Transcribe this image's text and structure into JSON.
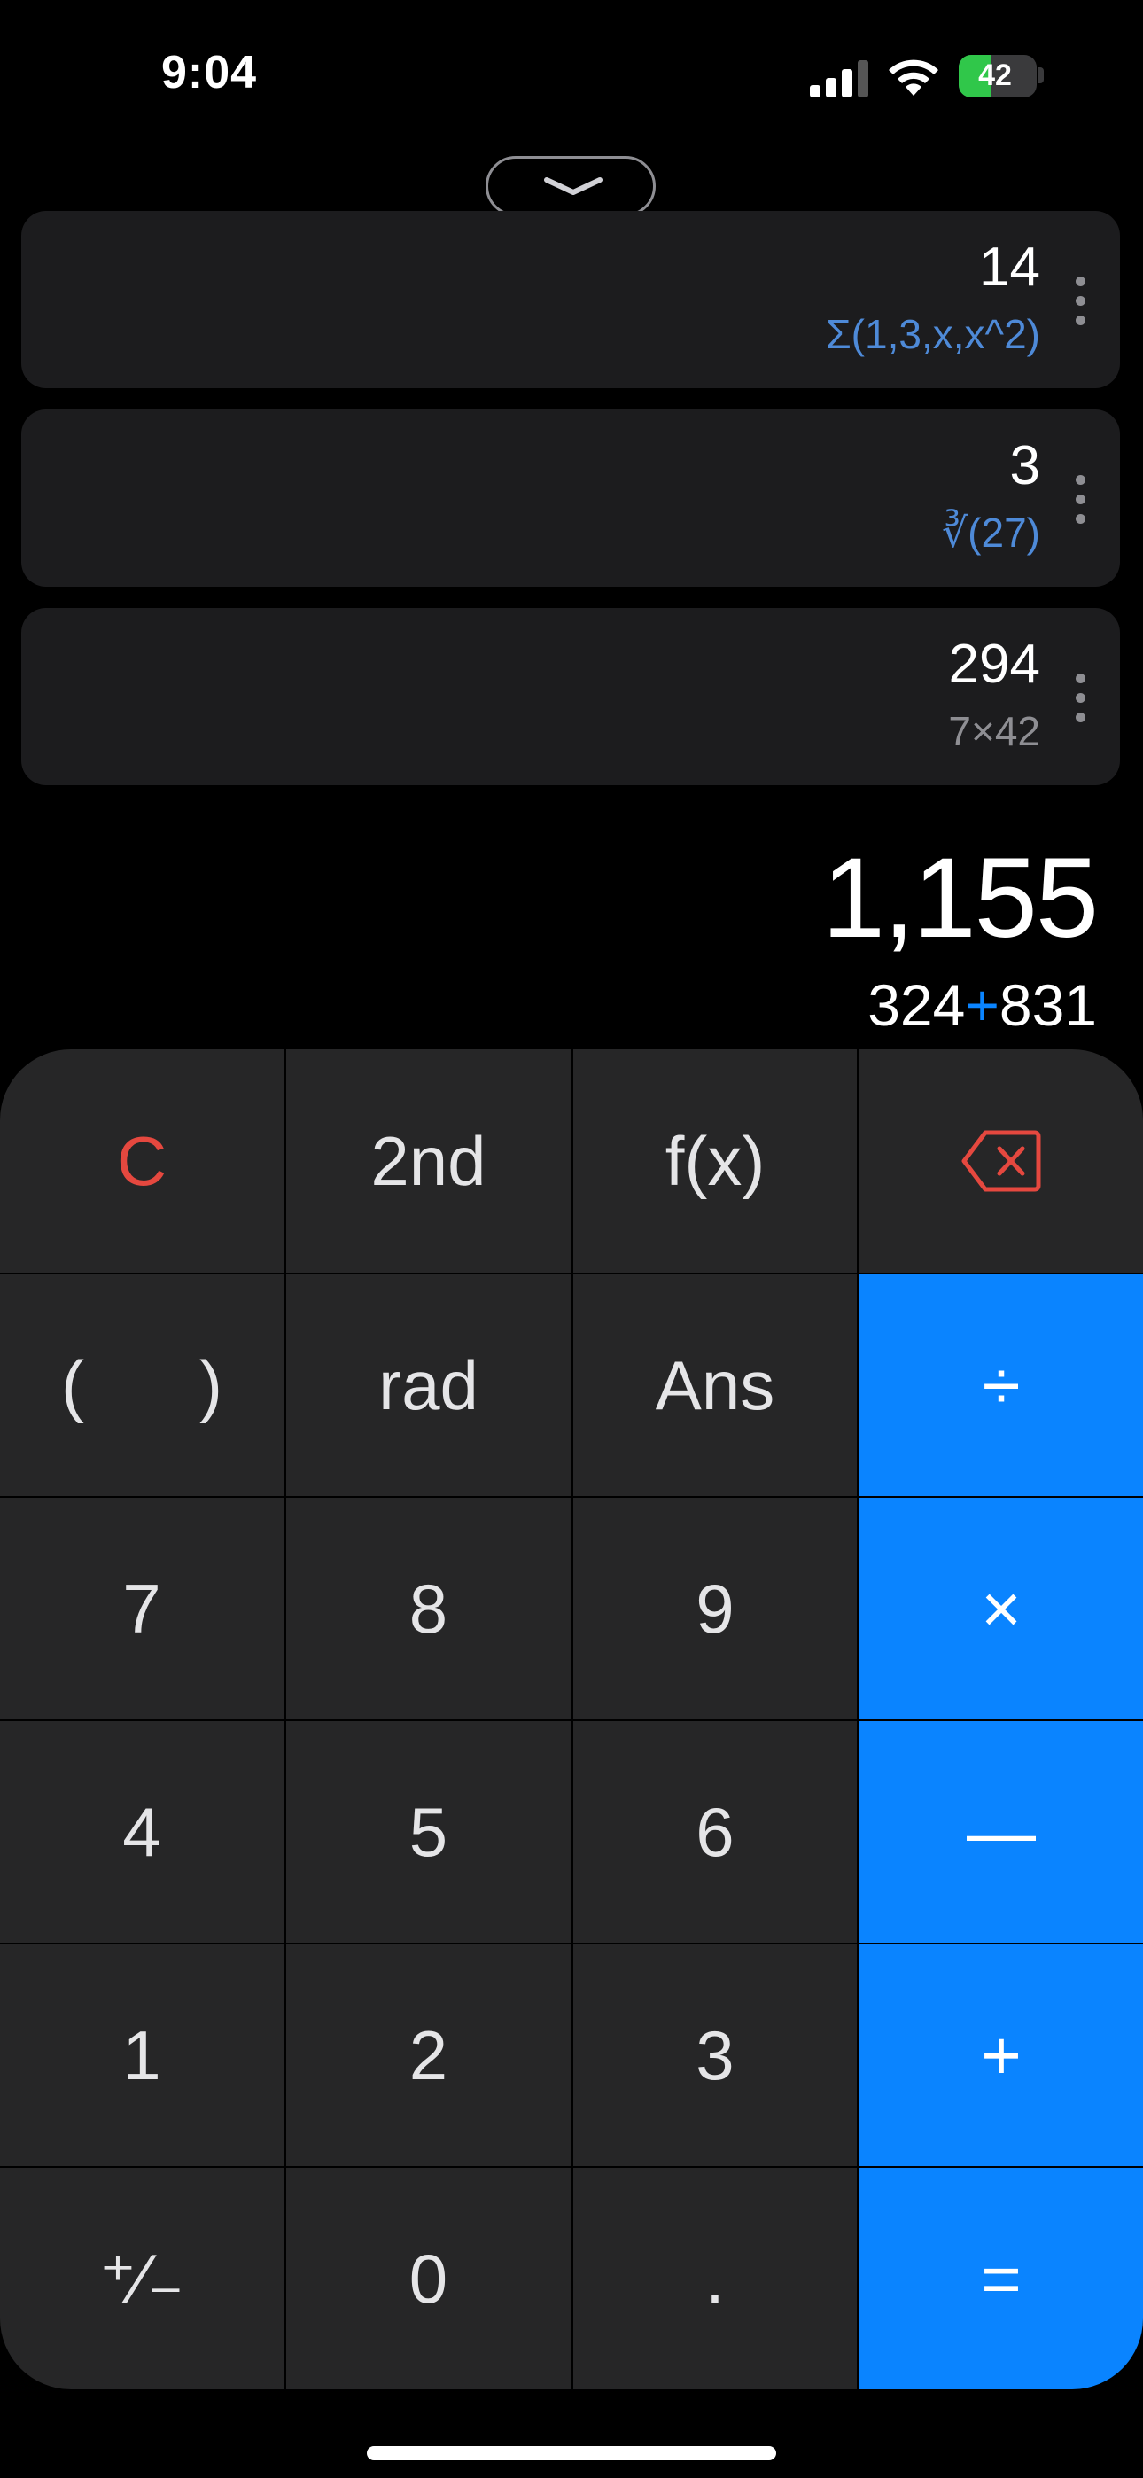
{
  "status_bar": {
    "time": "9:04",
    "battery_percent": "42",
    "battery_level": 0.42,
    "signal_bars": 3,
    "icons": [
      "cellular-signal-icon",
      "wifi-icon",
      "battery-charging-icon"
    ]
  },
  "history": [
    {
      "result": "14",
      "expression": "Σ(1,3,x,x^2)",
      "expression_color": "#4e8ad8"
    },
    {
      "result": "3",
      "expression": "∛(27)",
      "expression_color": "#4e8ad8"
    },
    {
      "result": "294",
      "expression": "7×42",
      "expression_color": "#8e8e93"
    }
  ],
  "display": {
    "result": "1,155",
    "expression_left": "324",
    "expression_operator": "+",
    "expression_right": "831"
  },
  "keypad": {
    "keys": [
      {
        "label": "C",
        "name": "clear-button",
        "type": "clear"
      },
      {
        "label": "2nd",
        "name": "second-function-button",
        "type": "fn"
      },
      {
        "label": "f(x)",
        "name": "function-button",
        "type": "fn"
      },
      {
        "label": "",
        "name": "backspace-button",
        "type": "backspace"
      },
      {
        "label": "(      )",
        "name": "parentheses-button",
        "type": "fn"
      },
      {
        "label": "rad",
        "name": "angle-mode-button",
        "type": "fn"
      },
      {
        "label": "Ans",
        "name": "answer-button",
        "type": "fn"
      },
      {
        "label": "÷",
        "name": "divide-button",
        "type": "op"
      },
      {
        "label": "7",
        "name": "digit-7-button",
        "type": "num"
      },
      {
        "label": "8",
        "name": "digit-8-button",
        "type": "num"
      },
      {
        "label": "9",
        "name": "digit-9-button",
        "type": "num"
      },
      {
        "label": "×",
        "name": "multiply-button",
        "type": "op"
      },
      {
        "label": "4",
        "name": "digit-4-button",
        "type": "num"
      },
      {
        "label": "5",
        "name": "digit-5-button",
        "type": "num"
      },
      {
        "label": "6",
        "name": "digit-6-button",
        "type": "num"
      },
      {
        "label": "—",
        "name": "subtract-button",
        "type": "op"
      },
      {
        "label": "1",
        "name": "digit-1-button",
        "type": "num"
      },
      {
        "label": "2",
        "name": "digit-2-button",
        "type": "num"
      },
      {
        "label": "3",
        "name": "digit-3-button",
        "type": "num"
      },
      {
        "label": "+",
        "name": "add-button",
        "type": "op"
      },
      {
        "label": "⁺∕₋",
        "name": "plus-minus-button",
        "type": "num"
      },
      {
        "label": "0",
        "name": "digit-0-button",
        "type": "num"
      },
      {
        "label": ".",
        "name": "decimal-button",
        "type": "num"
      },
      {
        "label": "=",
        "name": "equals-button",
        "type": "op"
      }
    ],
    "accent_color": "#0a84ff",
    "clear_color": "#e5483f",
    "key_color": "#262627"
  }
}
